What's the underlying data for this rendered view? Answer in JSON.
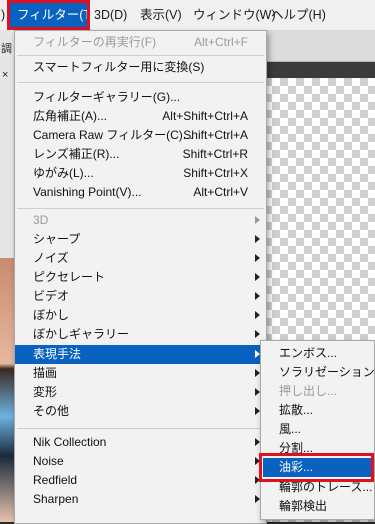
{
  "menubar": {
    "partial_left": ")",
    "filter": "フィルター(T)",
    "three_d": "3D(D)",
    "view": "表示(V)",
    "window": "ウィンドウ(W)",
    "help": "ヘルプ(H)"
  },
  "left_fragments": {
    "row1": "調",
    "row2": "×"
  },
  "filter_menu": {
    "last_filter": {
      "label": "フィルターの再実行(F)",
      "shortcut": "Alt+Ctrl+F"
    },
    "smart_filter": "スマートフィルター用に変換(S)",
    "gallery": {
      "label": "フィルターギャラリー(G)...",
      "shortcut": ""
    },
    "adaptive_wide": {
      "label": "広角補正(A)...",
      "shortcut": "Alt+Shift+Ctrl+A"
    },
    "camera_raw": {
      "label": "Camera Raw フィルター(C)...",
      "shortcut": "Shift+Ctrl+A"
    },
    "lens": {
      "label": "レンズ補正(R)...",
      "shortcut": "Shift+Ctrl+R"
    },
    "liquify": {
      "label": "ゆがみ(L)...",
      "shortcut": "Shift+Ctrl+X"
    },
    "vanishing": {
      "label": "Vanishing Point(V)...",
      "shortcut": "Alt+Ctrl+V"
    },
    "sub_3d": "3D",
    "sharpen_jp": "シャープ",
    "noise": "ノイズ",
    "pixelate": "ピクセレート",
    "video": "ビデオ",
    "blur": "ぼかし",
    "blur_gallery": "ぼかしギャラリー",
    "stylize": "表現手法",
    "render": "描画",
    "distort": "変形",
    "other": "その他",
    "nik": "Nik Collection",
    "noise_en": "Noise",
    "redfield": "Redfield",
    "sharpen_en": "Sharpen"
  },
  "stylize_submenu": {
    "emboss": "エンボス...",
    "solarize": "ソラリゼーション",
    "extrude": "押し出し...",
    "diffuse": "拡散...",
    "wind": "風...",
    "tiles": "分割...",
    "oil_paint": "油彩...",
    "trace_contour": "輪郭のトレース...",
    "find_edges": "輪郭検出"
  },
  "colors": {
    "accent": "#0a62c0",
    "highlight_box": "#e01020"
  }
}
